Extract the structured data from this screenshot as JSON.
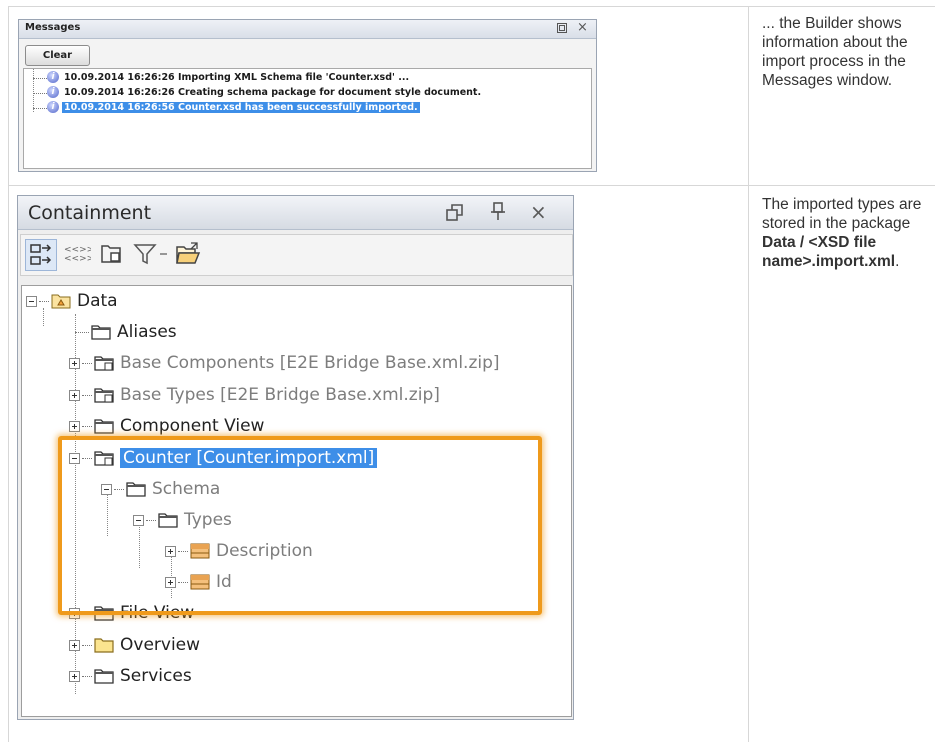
{
  "messages": {
    "title": "Messages",
    "clear_label": "Clear",
    "restore_icon": "restore-icon",
    "close_glyph": "×",
    "rows": [
      {
        "text": "10.09.2014 16:26:26 Importing XML Schema file 'Counter.xsd' ...",
        "selected": false
      },
      {
        "text": "10.09.2014 16:26:26 Creating schema package for document style document.",
        "selected": false
      },
      {
        "text": "10.09.2014 16:26:56 Counter.xsd has been successfully imported.",
        "selected": true
      }
    ]
  },
  "descriptions": {
    "first": "... the Builder shows information about the import process in the Messages window.",
    "second_prefix": "The imported types are stored in the package ",
    "second_bold": "Data / <XSD file name>.import.xml",
    "second_suffix": "."
  },
  "containment": {
    "title": "Containment",
    "toolbar_icons": [
      "expand-icon",
      "xml-icon",
      "package-tree-icon",
      "filter-icon",
      "open-folder-icon"
    ],
    "tree": {
      "root": "Data",
      "items": [
        {
          "label": "Aliases"
        },
        {
          "label": "Base Components [E2E Bridge Base.xml.zip]"
        },
        {
          "label": "Base Types [E2E Bridge Base.xml.zip]"
        },
        {
          "label": "Component View"
        },
        {
          "label": "Counter [Counter.import.xml]"
        },
        {
          "label": "Schema"
        },
        {
          "label": "Types"
        },
        {
          "label": "Description"
        },
        {
          "label": "Id"
        },
        {
          "label": "File View"
        },
        {
          "label": "Overview"
        },
        {
          "label": "Services"
        }
      ]
    }
  },
  "colors": {
    "selection": "#3d8ee8",
    "highlight": "#ef9a1b"
  }
}
